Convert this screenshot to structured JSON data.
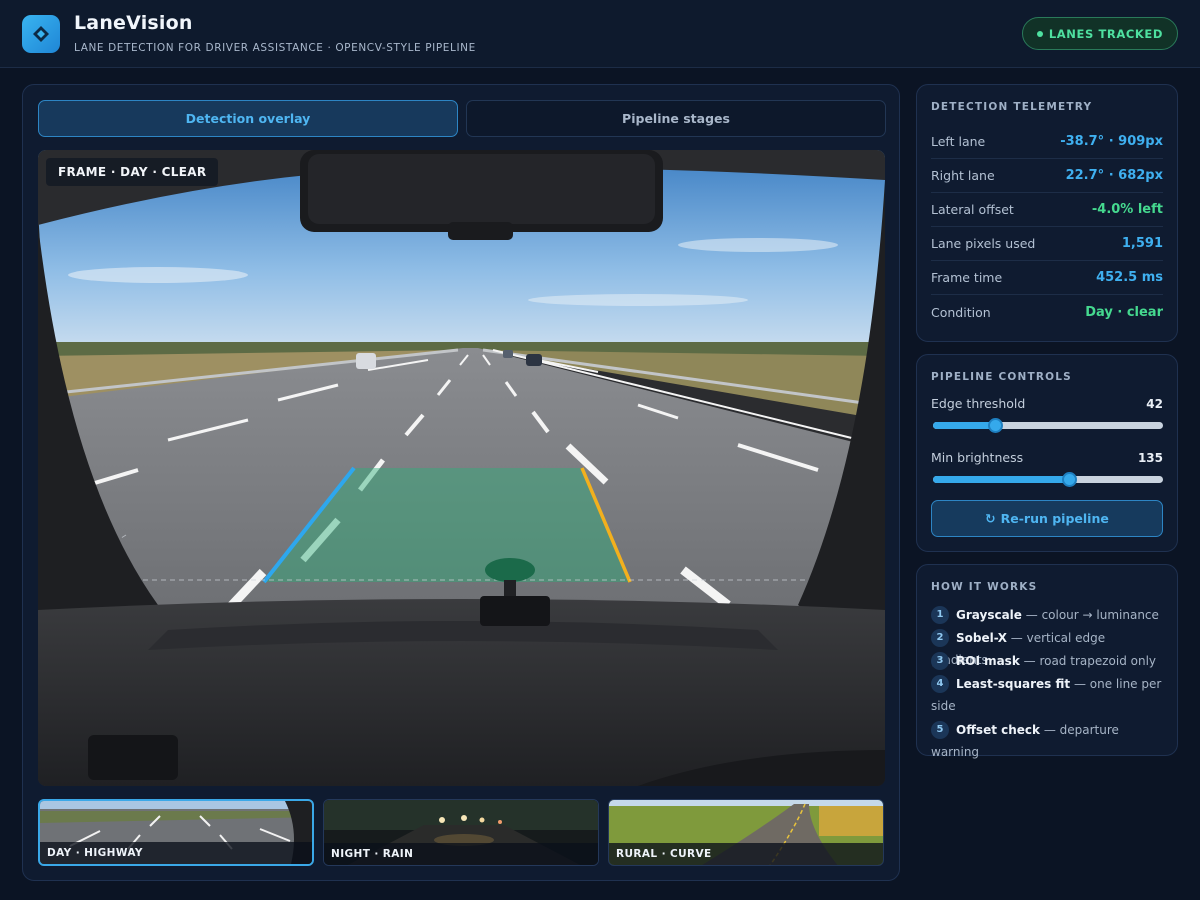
{
  "app": {
    "title": "LaneVision",
    "subtitle": "LANE DETECTION FOR DRIVER ASSISTANCE · OPENCV-STYLE PIPELINE",
    "status": "LANES TRACKED",
    "logo_icon": "diamond-icon"
  },
  "tabs": [
    {
      "label": "Detection overlay",
      "active": true
    },
    {
      "label": "Pipeline stages",
      "active": false
    }
  ],
  "viewer": {
    "frame_label": "FRAME  ·  DAY · CLEAR",
    "overlay_colors": {
      "left_lane": "#2ea7ee",
      "right_lane": "#f2b01e",
      "lane_fill": "#2fb07a"
    }
  },
  "thumbnails": [
    {
      "label": "DAY · HIGHWAY",
      "active": true
    },
    {
      "label": "NIGHT · RAIN",
      "active": false
    },
    {
      "label": "RURAL · CURVE",
      "active": false
    }
  ],
  "telemetry": {
    "title": "DETECTION TELEMETRY",
    "rows": [
      {
        "label": "Left lane",
        "value": "-38.7° · 909px",
        "color": "blue"
      },
      {
        "label": "Right lane",
        "value": "22.7° · 682px",
        "color": "blue"
      },
      {
        "label": "Lateral offset",
        "value": "-4.0% left",
        "color": "green"
      },
      {
        "label": "Lane pixels used",
        "value": "1,591",
        "color": "blue"
      },
      {
        "label": "Frame time",
        "value": "452.5 ms",
        "color": "blue"
      },
      {
        "label": "Condition",
        "value": "Day · clear",
        "color": "green"
      }
    ]
  },
  "controls": {
    "title": "PIPELINE CONTROLS",
    "sliders": [
      {
        "label": "Edge threshold",
        "value": "42",
        "fraction": 0.27
      },
      {
        "label": "Min brightness",
        "value": "135",
        "fraction": 0.59
      }
    ],
    "rerun_label": "Re-run pipeline",
    "rerun_icon": "refresh-icon"
  },
  "how_it_works": {
    "title": "HOW IT WORKS",
    "steps": [
      {
        "num": "1",
        "name": "Grayscale",
        "desc": " — colour → luminance"
      },
      {
        "num": "2",
        "name": "Sobel-X",
        "desc": " — vertical edge gradients"
      },
      {
        "num": "3",
        "name": "ROI mask",
        "desc": " — road trapezoid only"
      },
      {
        "num": "4",
        "name": "Least-squares fit",
        "desc": " — one line per side"
      },
      {
        "num": "5",
        "name": "Offset check",
        "desc": " — departure warning"
      }
    ]
  },
  "colors": {
    "accent": "#3fb0f0",
    "success": "#45d98f",
    "background": "#0b1424",
    "panel": "#0f1b30"
  }
}
